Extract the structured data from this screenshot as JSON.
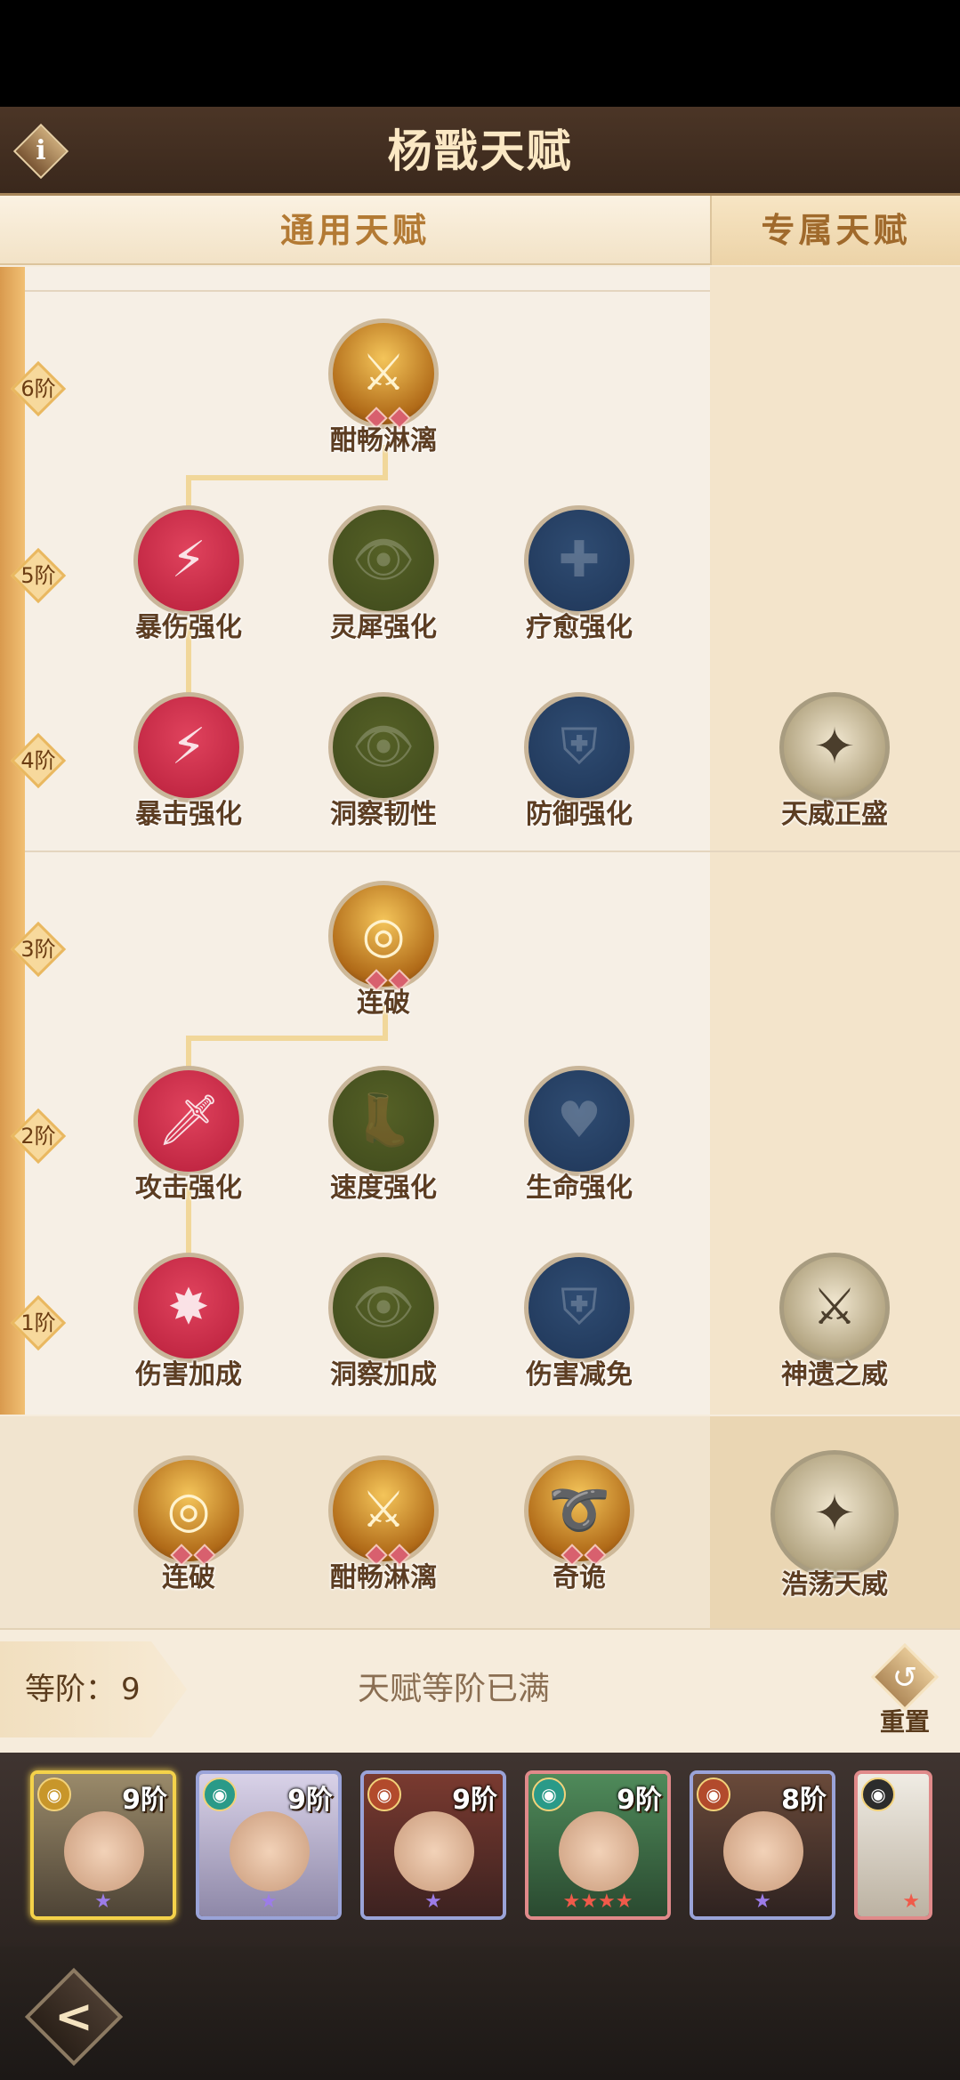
{
  "header": {
    "title": "杨戬天赋",
    "info_icon": "i"
  },
  "tabs": [
    {
      "label": "通用天赋",
      "active": true
    },
    {
      "label": "专属天赋",
      "active": false
    }
  ],
  "tiers": [
    "6阶",
    "5阶",
    "4阶",
    "3阶",
    "2阶",
    "1阶"
  ],
  "talents": {
    "t6": [
      {
        "name": "酣畅淋漓",
        "style": "gold",
        "gems": 2
      }
    ],
    "t5": [
      {
        "name": "暴伤强化",
        "style": "red",
        "active": true
      },
      {
        "name": "灵犀强化",
        "style": "olive",
        "active": false
      },
      {
        "name": "疗愈强化",
        "style": "navy",
        "active": false
      }
    ],
    "t4": [
      {
        "name": "暴击强化",
        "style": "red",
        "active": true
      },
      {
        "name": "洞察韧性",
        "style": "olive",
        "active": false
      },
      {
        "name": "防御强化",
        "style": "navy",
        "active": false
      }
    ],
    "t3": [
      {
        "name": "连破",
        "style": "gold",
        "gems": 2
      }
    ],
    "t2": [
      {
        "name": "攻击强化",
        "style": "red",
        "active": true
      },
      {
        "name": "速度强化",
        "style": "olive",
        "active": false
      },
      {
        "name": "生命强化",
        "style": "navy",
        "active": false
      }
    ],
    "t1": [
      {
        "name": "伤害加成",
        "style": "red",
        "active": true
      },
      {
        "name": "洞察加成",
        "style": "olive",
        "active": false
      },
      {
        "name": "伤害减免",
        "style": "navy",
        "active": false
      }
    ]
  },
  "exclusive": [
    {
      "name": "天威正盛"
    },
    {
      "name": "神遗之威"
    }
  ],
  "equipped": [
    {
      "name": "连破",
      "gems": 2
    },
    {
      "name": "酣畅淋漓",
      "gems": 2
    },
    {
      "name": "奇诡",
      "gems": 2
    },
    {
      "name": "浩荡天威"
    }
  ],
  "status": {
    "rank_label": "等阶：",
    "rank_value": "9",
    "maxed_text": "天赋等阶已满",
    "reset_label": "重置"
  },
  "roster": [
    {
      "level": "9阶",
      "stars": "★",
      "star_color": "purple",
      "faction": "gold",
      "selected": true
    },
    {
      "level": "9阶",
      "stars": "★",
      "star_color": "purple",
      "faction": "teal"
    },
    {
      "level": "9阶",
      "stars": "★",
      "star_color": "purple",
      "faction": "red"
    },
    {
      "level": "9阶",
      "stars": "★★★★",
      "star_color": "red",
      "faction": "teal"
    },
    {
      "level": "8阶",
      "stars": "★",
      "star_color": "purple",
      "faction": "red"
    },
    {
      "level": "",
      "stars": "★",
      "star_color": "red",
      "faction": "dark"
    }
  ],
  "colors": {
    "accent_gold": "#b37a34",
    "header_bg": "#3a281c",
    "rail": "#e0a85a"
  }
}
